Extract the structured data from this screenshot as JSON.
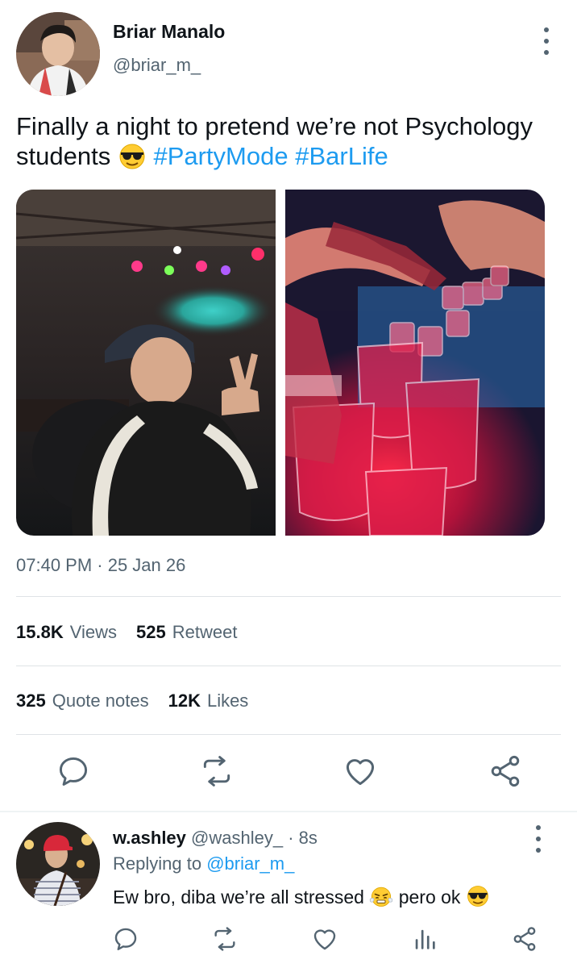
{
  "tweet": {
    "author_name": "Briar Manalo",
    "author_handle": "@briar_m_",
    "text_before": "Finally a night to pretend we’re not Psychology students",
    "emoji": "sunglasses-face",
    "hashtags": [
      "#PartyMode",
      "#BarLife"
    ],
    "timestamp": "07:40 PM · 25 Jan 26",
    "stats": {
      "views_count": "15.8K",
      "views_label": "Views",
      "retweet_count": "525",
      "retweet_label": "Retweet",
      "quote_count": "325",
      "quote_label": "Quote notes",
      "likes_count": "12K",
      "likes_label": "Likes"
    },
    "actions": [
      "reply-icon",
      "retweet-icon",
      "like-icon",
      "share-icon"
    ]
  },
  "reply": {
    "author_name": "w.ashley",
    "author_handle": "@washley_",
    "dot": "·",
    "time": "8s",
    "replying_prefix": "Replying to",
    "replying_handle": "@briar_m_",
    "text_part1": "Ew bro, diba we’re all stressed",
    "emoji1": "steam-face",
    "text_part2": "pero ok",
    "emoji2": "sunglasses-face",
    "actions": [
      "reply-icon",
      "retweet-icon",
      "like-icon",
      "views-icon",
      "share-icon"
    ]
  },
  "colors": {
    "link": "#1d9bf0",
    "muted": "#536471",
    "text": "#0f1419",
    "divider": "#dfe3e6"
  }
}
